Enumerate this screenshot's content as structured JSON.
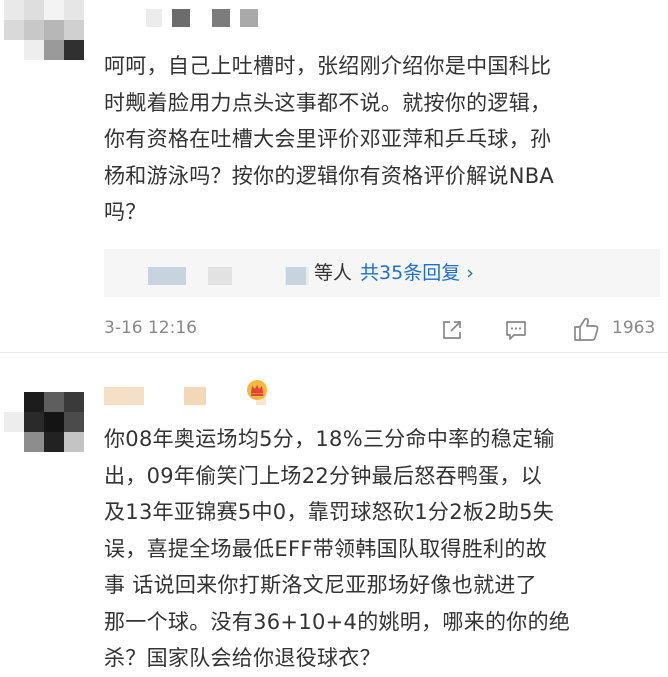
{
  "comments": [
    {
      "text": "呵呵，自己上吐槽时，张绍刚介绍你是中国科比\n时觍着脸用力点头这事都不说。就按你的逻辑，\n你有资格在吐槽大会里评价邓亚萍和乒乓球，孙\n杨和游泳吗？按你的逻辑你有资格评价解说NBA\n吗？",
      "replies": {
        "suffix": "等人",
        "link": "共35条回复",
        "arrow": "›"
      },
      "time": "3-16 12:16",
      "likes": "1963",
      "icons": [
        "share-icon",
        "comment-icon",
        "like-icon"
      ]
    },
    {
      "text": "你08年奥运场均5分，18%三分命中率的稳定输\n出，09年偷笑门上场22分钟最后怒吞鸭蛋，以\n及13年亚锦赛5中0，靠罚球怒砍1分2板2助5失\n误，喜提全场最低EFF带领韩国队取得胜利的故\n事 话说回来你打斯洛文尼亚那场好像也就进了\n那一个球。没有36+10+4的姚明，哪来的你的绝\n杀？国家队会给你退役球衣？",
      "badge_icon": "crown-badge-icon"
    }
  ],
  "colors": {
    "link": "#1f6fc4",
    "meta": "#888888",
    "text": "#333333",
    "reply_bg": "#f6f6f6"
  }
}
